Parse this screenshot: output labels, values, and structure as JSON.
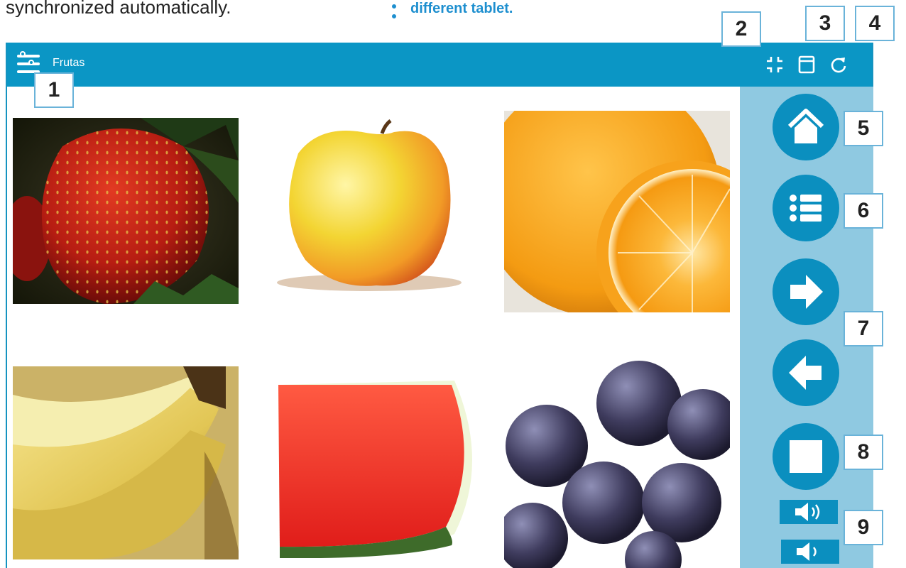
{
  "doc": {
    "left_text": "synchronized automatically.",
    "right_text": "different tablet."
  },
  "app": {
    "title": "Frutas",
    "toolbar": {
      "icons": [
        "collapse-icon",
        "window-icon",
        "refresh-icon"
      ]
    }
  },
  "tiles": [
    {
      "name": "strawberry",
      "label": ""
    },
    {
      "name": "apple",
      "label": ""
    },
    {
      "name": "orange",
      "label": ""
    },
    {
      "name": "banana",
      "label": ""
    },
    {
      "name": "watermelon",
      "label": ""
    },
    {
      "name": "grapes",
      "label": ""
    }
  ],
  "sidebar": {
    "buttons": [
      "home-icon",
      "list-icon",
      "arrow-right-icon",
      "arrow-left-icon",
      "stop-icon",
      "volume-up-icon",
      "volume-down-icon"
    ]
  },
  "callouts": {
    "c1": "1",
    "c2": "2",
    "c3": "3",
    "c4": "4",
    "c5": "5",
    "c6": "6",
    "c7": "7",
    "c8": "8",
    "c9": "9"
  },
  "colors": {
    "accent": "#0b96c5",
    "sidebar": "#8fc9e1",
    "button": "#0b8fbf"
  }
}
